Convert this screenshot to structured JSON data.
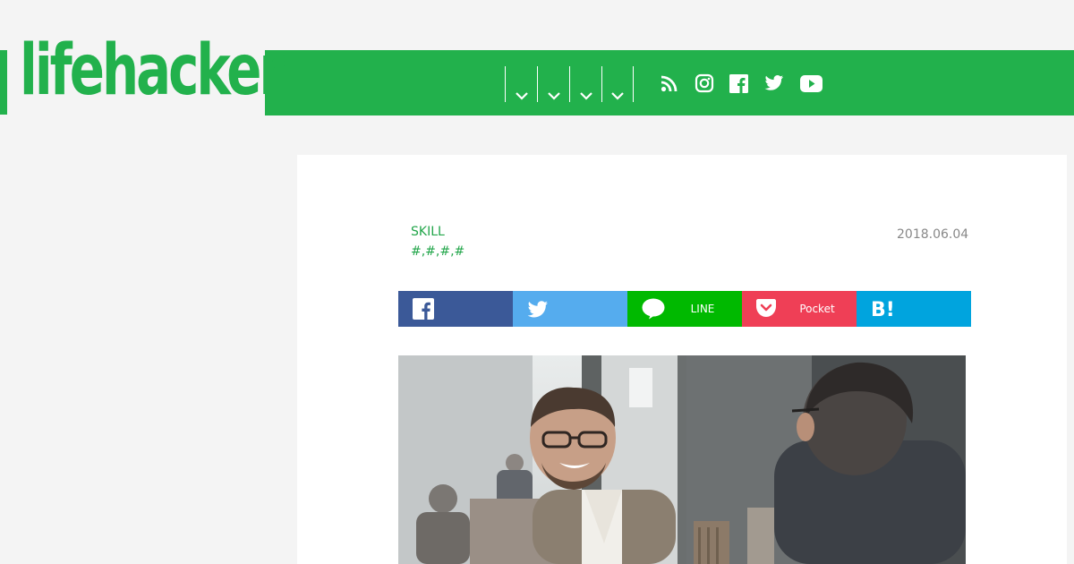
{
  "brand": {
    "logo_text": "lifehacker",
    "green": "#22b14c"
  },
  "nav": {
    "menus": [
      {
        "icon": "chevron-down-icon"
      },
      {
        "icon": "chevron-down-icon"
      },
      {
        "icon": "chevron-down-icon"
      },
      {
        "icon": "chevron-down-icon"
      }
    ],
    "social": [
      "rss-icon",
      "instagram-icon",
      "facebook-icon",
      "twitter-icon",
      "youtube-icon"
    ]
  },
  "article": {
    "category": "SKILL",
    "tags": "#,#,#,#",
    "date": "2018.06.04"
  },
  "share": {
    "facebook": {
      "label": "",
      "color": "#3b5998",
      "icon": "facebook-icon"
    },
    "twitter": {
      "label": "",
      "color": "#55acee",
      "icon": "twitter-icon"
    },
    "line": {
      "label": "LINE",
      "color": "#00b900",
      "icon": "line-icon"
    },
    "pocket": {
      "label": "Pocket",
      "color": "#ef3f56",
      "icon": "pocket-icon"
    },
    "hatena": {
      "label": "",
      "color": "#00a4de",
      "icon": "hatena-bookmark-icon"
    }
  },
  "hero_image": {
    "subject": "two men talking at a cafe table"
  }
}
